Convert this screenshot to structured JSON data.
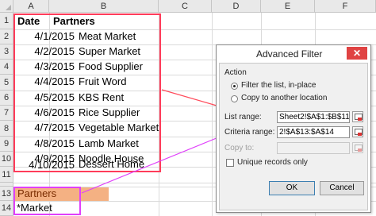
{
  "sheet": {
    "columns": [
      "A",
      "B",
      "C",
      "D",
      "E",
      "F"
    ],
    "rows": [
      "1",
      "2",
      "3",
      "4",
      "5",
      "6",
      "7",
      "8",
      "9",
      "10",
      "11",
      "12",
      "13",
      "14"
    ],
    "header": {
      "date": "Date",
      "partners": "Partners"
    },
    "data": [
      {
        "date": "4/1/2015",
        "partner": "Meat Market"
      },
      {
        "date": "4/2/2015",
        "partner": "Super Market"
      },
      {
        "date": "4/3/2015",
        "partner": "Food Supplier"
      },
      {
        "date": "4/4/2015",
        "partner": "Fruit Word"
      },
      {
        "date": "4/5/2015",
        "partner": "KBS Rent"
      },
      {
        "date": "4/6/2015",
        "partner": "Rice Supplier"
      },
      {
        "date": "4/7/2015",
        "partner": "Vegetable Market"
      },
      {
        "date": "4/8/2015",
        "partner": "Lamb Market"
      },
      {
        "date": "4/9/2015",
        "partner": "Noodle House"
      },
      {
        "date": "4/10/2015",
        "partner": "Dessert Home"
      }
    ],
    "criteria": {
      "header": "Partners",
      "value": "*Market"
    },
    "colors": {
      "criteria_fill": "#f4b183",
      "list_outline": "#ff3c5a",
      "criteria_outline": "#e040fb"
    }
  },
  "dialog": {
    "title": "Advanced Filter",
    "close_glyph": "✕",
    "action_label": "Action",
    "filter_in_place": "Filter the list, in-place",
    "copy_to_location": "Copy to another location",
    "list_range_label": "List range:",
    "list_range_value": "Sheet2!$A$1:$B$11",
    "criteria_range_label": "Criteria range:",
    "criteria_range_value": "2!$A$13:$A$14",
    "copy_to_label": "Copy to:",
    "copy_to_value": "",
    "unique_label": "Unique records only",
    "ok_label": "OK",
    "cancel_label": "Cancel",
    "selected_action": "filter_in_place",
    "unique_checked": false
  }
}
